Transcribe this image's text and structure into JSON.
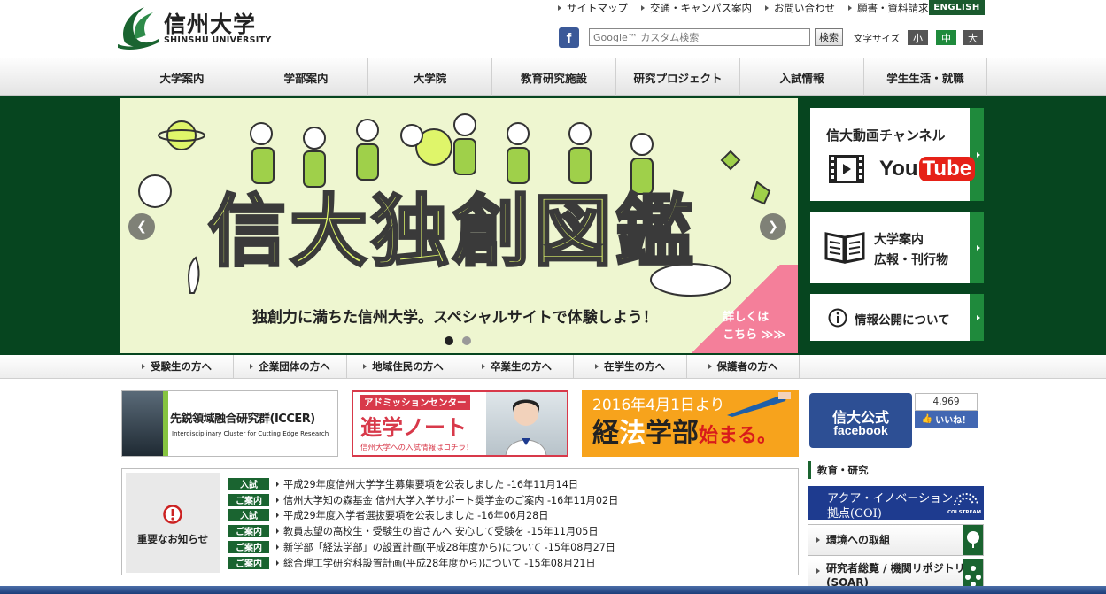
{
  "header": {
    "logo_jp": "信州大学",
    "logo_en": "SHINSHU UNIVERSITY",
    "top_links": [
      "サイトマップ",
      "交通・キャンパス案内",
      "お問い合わせ",
      "願書・資料請求"
    ],
    "english": "ENGLISH",
    "search_placeholder": "Google™ カスタム検索",
    "search_button": "検索",
    "font_size_label": "文字サイズ",
    "font_sizes": [
      "小",
      "中",
      "大"
    ]
  },
  "nav": [
    "大学案内",
    "学部案内",
    "大学院",
    "教育研究施設",
    "研究プロジェクト",
    "入試情報",
    "学生生活・就職"
  ],
  "hero": {
    "title": "信大独創図鑑",
    "subtitle": "独創力に満ちた信州大学。スペシャルサイトで体験しよう！",
    "more": "詳しくは\nこちら ≫≫"
  },
  "side": {
    "video_title": "信大動画チャンネル",
    "youtube_you": "You",
    "youtube_tube": "Tube",
    "guide_line1": "大学案内",
    "guide_line2": "広報・刊行物",
    "disclosure": "情報公開について"
  },
  "subnav": [
    "受験生の方へ",
    "企業団体の方へ",
    "地域住民の方へ",
    "卒業生の方へ",
    "在学生の方へ",
    "保護者の方へ"
  ],
  "banners": {
    "iccer_title": "先鋭領域融合研究群(ICCER)",
    "iccer_sub": "Interdisciplinary Cluster for Cutting Edge Research",
    "adm_top": "アドミッションセンター",
    "adm_main": "進学ノート",
    "adm_sub": "信州大学への入試情報はコチラ！",
    "law_top": "2016年4月1日より",
    "law_a": "経",
    "law_b": "法",
    "law_c": "学部",
    "law_d": "始まる。",
    "fb_line1": "信大公式",
    "fb_line2": "facebook",
    "like_count": "4,969",
    "like_label": "いいね！"
  },
  "news": {
    "heading": "重要なお知らせ",
    "items": [
      {
        "tag": "入試",
        "text": "平成29年度信州大学学生募集要項を公表しました -16年11月14日"
      },
      {
        "tag": "ご案内",
        "text": "信州大学知の森基金  信州大学入学サポート奨学金のご案内 -16年11月02日"
      },
      {
        "tag": "入試",
        "text": "平成29年度入学者選抜要項を公表しました -16年06月28日"
      },
      {
        "tag": "ご案内",
        "text": "教員志望の高校生・受験生の皆さんへ 安心して受験を -15年11月05日"
      },
      {
        "tag": "ご案内",
        "text": "新学部「経法学部」の設置計画(平成28年度から)について -15年08月27日"
      },
      {
        "tag": "ご案内",
        "text": "総合理工学研究科設置計画(平成28年度から)について -15年08月21日"
      }
    ]
  },
  "right": {
    "section": "教育・研究",
    "coi_line1": "アクア・イノベーション",
    "coi_line2": "拠点(COI)",
    "coi_badge": "COI STREAM",
    "env": "環境への取組",
    "soar_line1": "研究者総覧 / 機関リポジトリ",
    "soar_line2": "(SOAR)"
  },
  "colors": {
    "brand_green": "#06451f",
    "accent_green": "#1f8a3c",
    "tag_green": "#1a6430",
    "facebook_blue": "#3b5998",
    "youtube_red": "#e62117",
    "law_orange": "#f7a31c",
    "admission_red": "#d8394a"
  }
}
